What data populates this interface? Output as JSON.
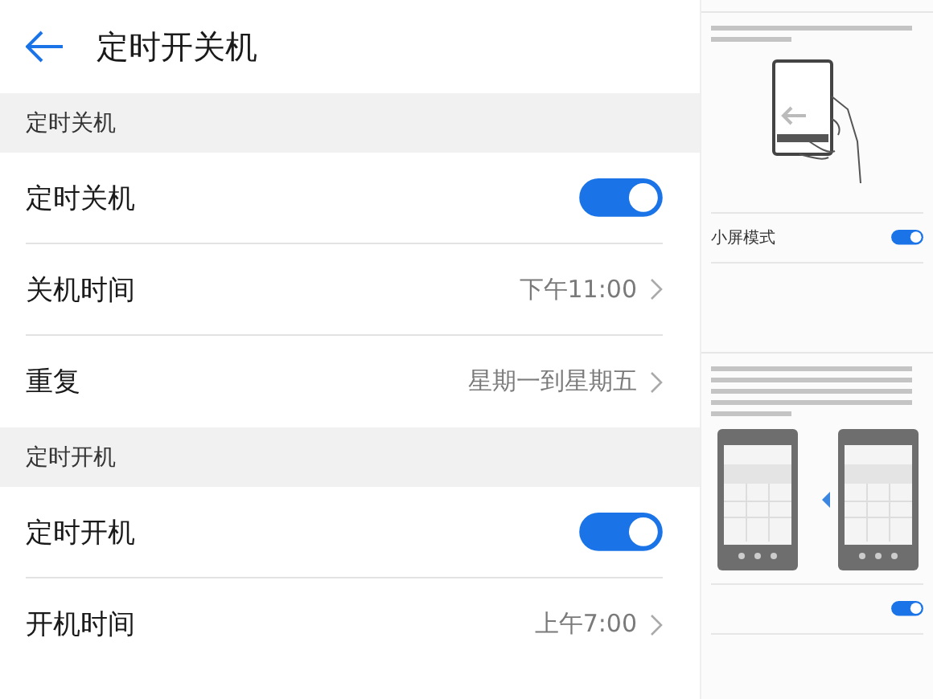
{
  "header": {
    "title": "定时开关机"
  },
  "sections": [
    {
      "title": "定时关机",
      "rows": [
        {
          "kind": "switch",
          "label": "定时关机",
          "on": true
        },
        {
          "kind": "value",
          "label": "关机时间",
          "value": "下午11:00"
        },
        {
          "kind": "value",
          "label": "重复",
          "value": "星期一到星期五"
        }
      ]
    },
    {
      "title": "定时开机",
      "rows": [
        {
          "kind": "switch",
          "label": "定时开机",
          "on": true
        },
        {
          "kind": "value",
          "label": "开机时间",
          "value": "上午7:00"
        }
      ]
    }
  ],
  "side_screens": [
    {
      "kind": "hand",
      "setting": {
        "label": "小屏模式",
        "on": true
      }
    },
    {
      "kind": "keyboards",
      "setting": {
        "on": true
      }
    }
  ]
}
